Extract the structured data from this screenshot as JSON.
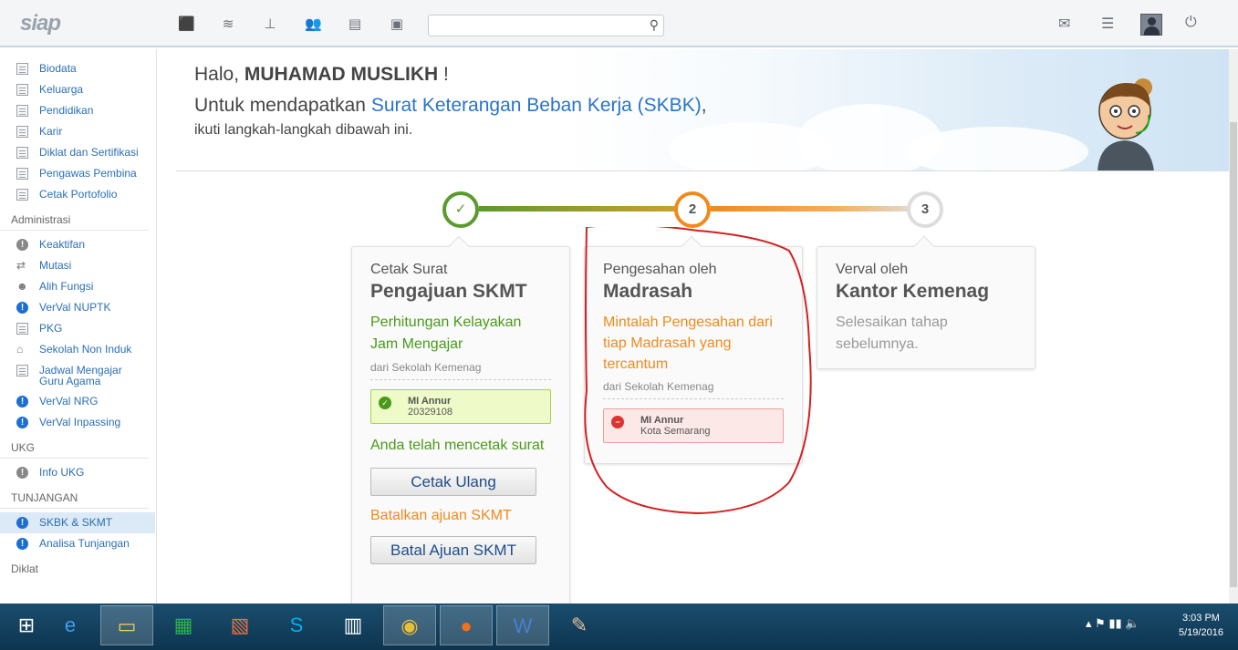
{
  "app": {
    "logo": "siap"
  },
  "search": {
    "placeholder": ""
  },
  "sidebar": {
    "top_items": [
      {
        "label": "Biodata",
        "icon": "doc-icon"
      },
      {
        "label": "Keluarga",
        "icon": "doc-icon"
      },
      {
        "label": "Pendidikan",
        "icon": "doc-icon"
      },
      {
        "label": "Karir",
        "icon": "doc-icon"
      },
      {
        "label": "Diklat dan Sertifikasi",
        "icon": "doc-icon"
      },
      {
        "label": "Pengawas Pembina",
        "icon": "doc-icon"
      },
      {
        "label": "Cetak Portofolio",
        "icon": "doc-icon"
      }
    ],
    "admin_head": "Administrasi",
    "admin_items": [
      {
        "label": "Keaktifan",
        "icon": "grey-info-icon"
      },
      {
        "label": "Mutasi",
        "icon": "transfer-icon"
      },
      {
        "label": "Alih Fungsi",
        "icon": "user-icon"
      },
      {
        "label": "VerVal NUPTK",
        "icon": "info-icon"
      },
      {
        "label": "PKG",
        "icon": "chart-icon"
      },
      {
        "label": "Sekolah Non Induk",
        "icon": "school-icon"
      },
      {
        "label": "Jadwal Mengajar Guru Agama",
        "line1": "Jadwal Mengajar",
        "line2": "Guru Agama",
        "icon": "doc-icon"
      },
      {
        "label": "VerVal NRG",
        "icon": "info-icon"
      },
      {
        "label": "VerVal Inpassing",
        "icon": "info-icon"
      }
    ],
    "ukg_head": "UKG",
    "ukg_items": [
      {
        "label": "Info UKG",
        "icon": "grey-info-icon"
      }
    ],
    "tunjangan_head": "TUNJANGAN",
    "tunjangan_items": [
      {
        "label": "SKBK & SKMT",
        "icon": "info-icon",
        "active": true
      },
      {
        "label": "Analisa Tunjangan",
        "icon": "info-icon"
      }
    ],
    "diklat_head": "Diklat"
  },
  "hero": {
    "greeting_prefix": "Halo,",
    "user_name": "MUHAMAD MUSLIKH",
    "greeting_suffix": "!",
    "intro_prefix": "Untuk mendapatkan",
    "intro_link": "Surat Keterangan Beban Kerja (SKBK)",
    "intro_suffix": ",",
    "sub": "ikuti langkah-langkah dibawah ini."
  },
  "steps": [
    {
      "number": "✓",
      "title": "Cetak Surat",
      "subtitle": "Pengajuan SKMT",
      "desc": "Perhitungan Kelayakan Jam Mengajar",
      "from": "dari Sekolah Kemenag",
      "box_name": "MI Annur",
      "box_detail": "20329108",
      "note": "Anda telah mencetak surat",
      "reprint_button": "Cetak Ulang",
      "cancel_link": "Batalkan ajuan SKMT",
      "cancel_button": "Batal Ajuan SKMT"
    },
    {
      "number": "2",
      "title": "Pengesahan oleh",
      "subtitle": "Madrasah",
      "desc": "Mintalah Pengesahan dari tiap Madrasah yang tercantum",
      "from": "dari Sekolah Kemenag",
      "box_name": "MI Annur",
      "box_detail": "Kota Semarang"
    },
    {
      "number": "3",
      "title": "Verval oleh",
      "subtitle": "Kantor Kemenag",
      "desc": "Selesaikan tahap sebelumnya."
    }
  ],
  "colors": {
    "done": "#5a9a2e",
    "active": "#f08a1c",
    "pending": "#cccccc",
    "link": "#2b74c7"
  },
  "taskbar": {
    "time": "3:03 PM",
    "date": "5/19/2016"
  }
}
